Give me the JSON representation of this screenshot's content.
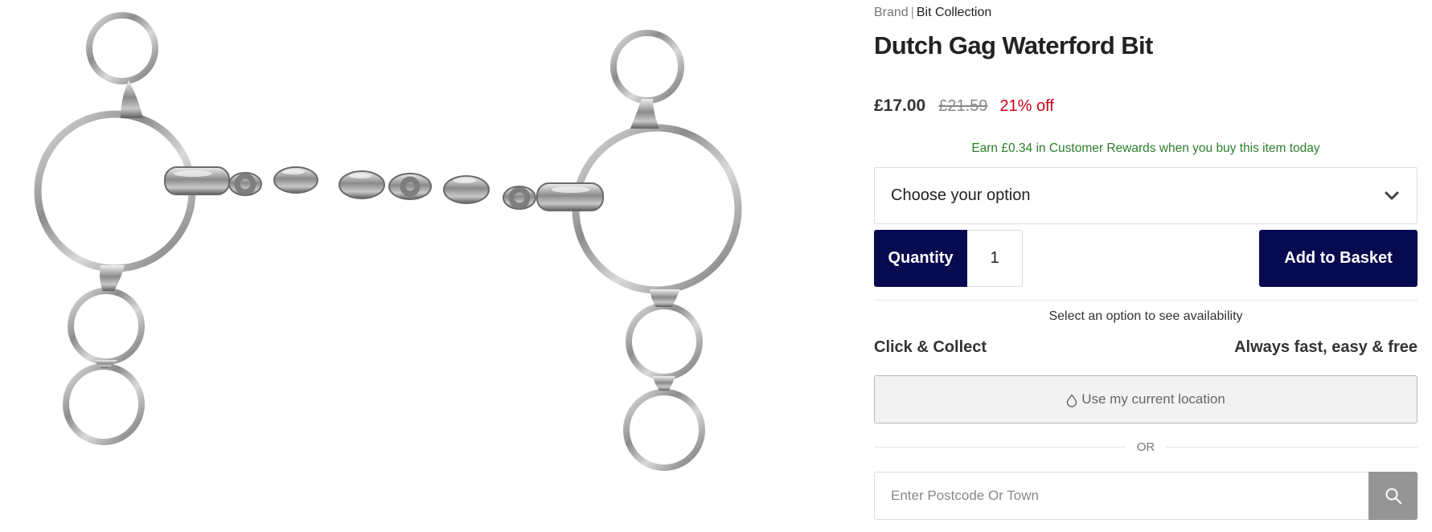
{
  "product_image": {
    "icon": "dutch-gag-bit-image"
  },
  "breadcrumb": {
    "brand": "Brand",
    "separator": "|",
    "collection": "Bit Collection"
  },
  "product": {
    "title": "Dutch Gag Waterford Bit"
  },
  "pricing": {
    "current": "£17.00",
    "previous": "£21.59",
    "discount": "21% off",
    "discount_color": "#d0021b"
  },
  "rewards": {
    "text": "Earn £0.34 in Customer Rewards when you buy this item today",
    "color": "#2c7d2c"
  },
  "option_select": {
    "label": "Choose your option",
    "icon": "chevron-down-icon"
  },
  "quantity": {
    "label": "Quantity",
    "value": "1"
  },
  "add_to_basket": {
    "label": "Add to Basket",
    "color": "#070a4e"
  },
  "availability": {
    "text": "Select an option to see availability"
  },
  "click_collect": {
    "title": "Click & Collect",
    "subtitle": "Always fast, easy & free"
  },
  "location": {
    "label": "Use my current location",
    "icon": "location-pin-icon"
  },
  "or_divider": {
    "text": "OR"
  },
  "postcode_search": {
    "placeholder": "Enter Postcode Or Town",
    "value": "",
    "icon": "search-icon"
  }
}
